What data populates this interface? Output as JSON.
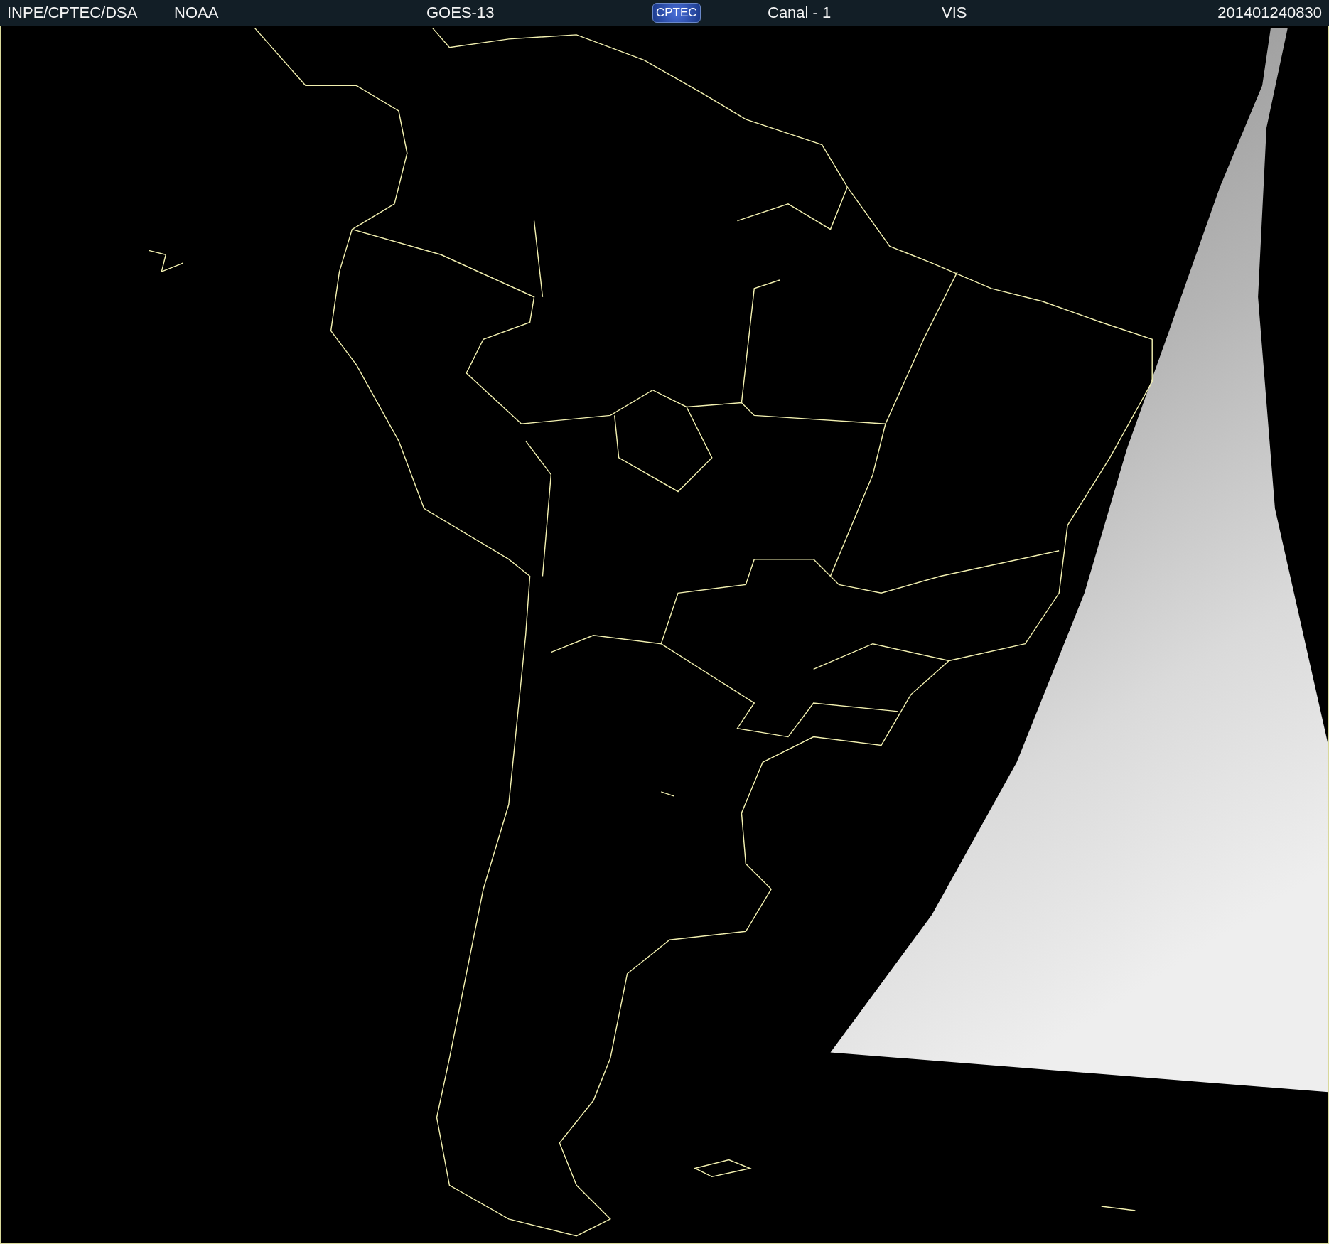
{
  "header": {
    "institution": "INPE/CPTEC/DSA",
    "agency": "NOAA",
    "satellite": "GOES-13",
    "logo": "CPTEC",
    "channel": "Canal - 1",
    "band": "VIS",
    "timestamp": "201401240830"
  }
}
